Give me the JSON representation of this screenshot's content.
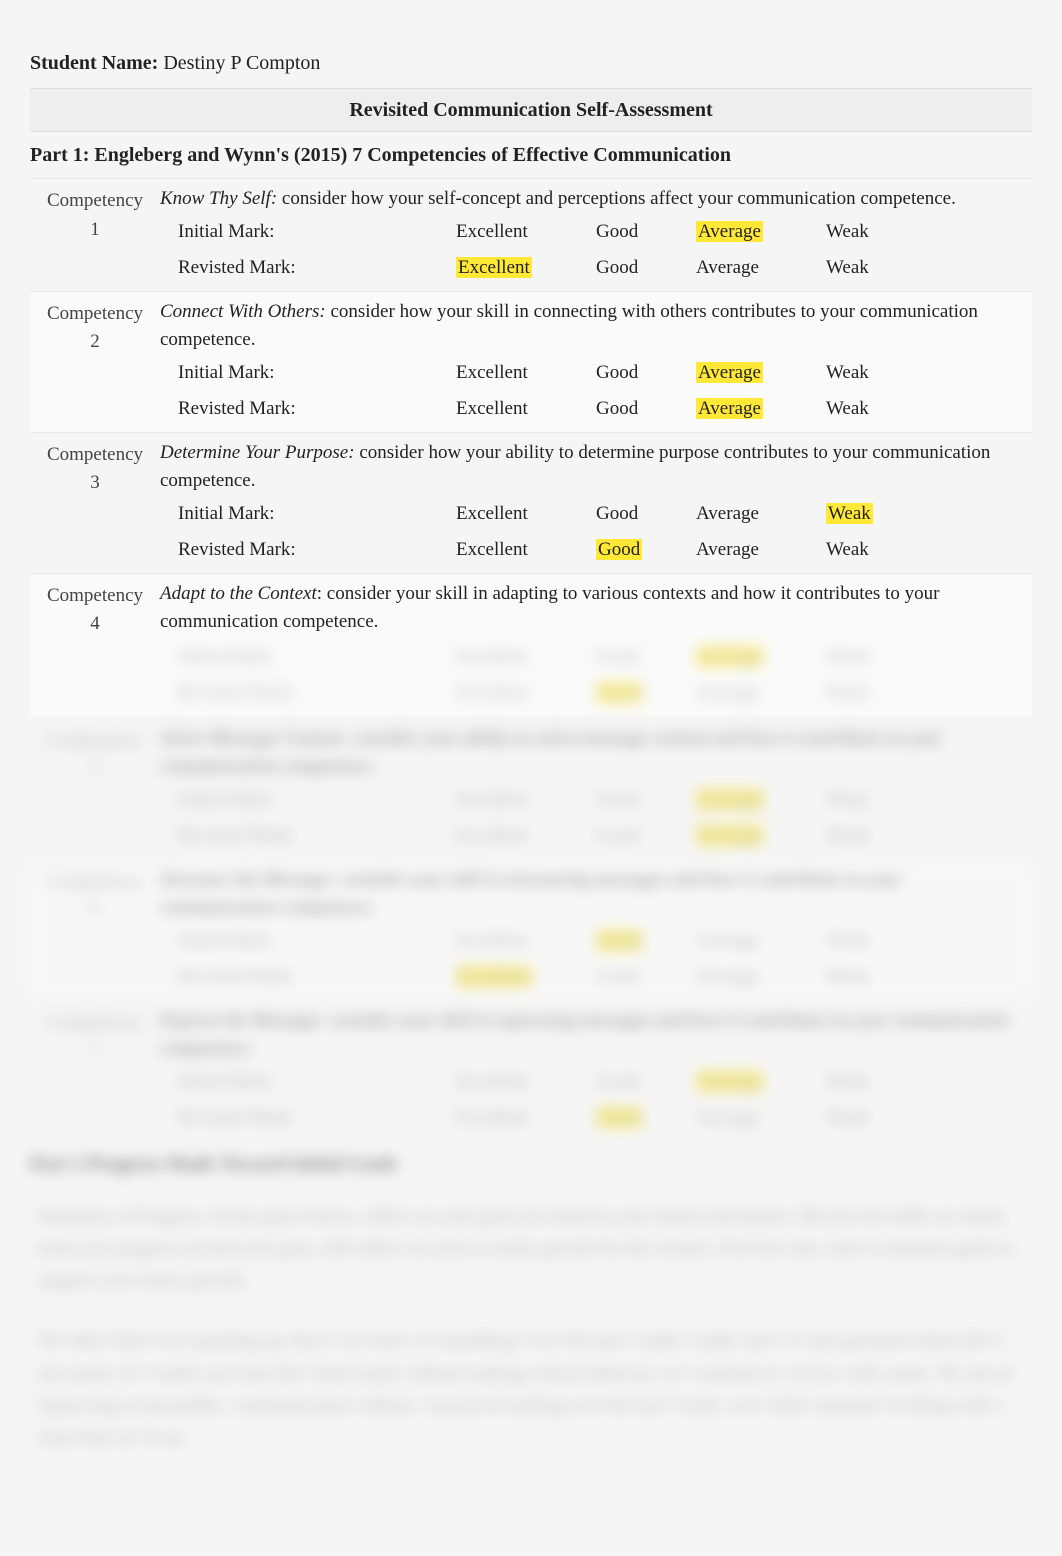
{
  "student": {
    "label": "Student Name:",
    "name": "Destiny P Compton"
  },
  "title": "Revisited Communication Self-Assessment",
  "part1_header": "Part 1: Engleberg and Wynn's (2015) 7 Competencies of Effective Communication",
  "ratings": {
    "excellent": "Excellent",
    "good": "Good",
    "average": "Average",
    "weak": "Weak"
  },
  "marks": {
    "initial": "Initial Mark:",
    "revisted": "Revisted Mark:"
  },
  "comp": {
    "c1": {
      "label_a": "Competency",
      "label_b": "1",
      "title": "Know Thy Self:",
      "desc": " consider how your self-concept and perceptions affect your communication competence.",
      "initial_hl": "average",
      "revisted_hl": "excellent"
    },
    "c2": {
      "label_a": "Competency",
      "label_b": "2",
      "title": "Connect With Others:",
      "desc": " consider how your skill in connecting with others contributes to your communication competence.",
      "initial_hl": "average",
      "revisted_hl": "average"
    },
    "c3": {
      "label_a": "Competency",
      "label_b": "3",
      "title": "Determine Your Purpose:",
      "desc": " consider how your ability to determine purpose contributes to your communication competence.",
      "initial_hl": "weak",
      "revisted_hl": "good"
    },
    "c4": {
      "label_a": "Competency",
      "label_b": "4",
      "title": "Adapt to the Context",
      "desc": ": consider your skill in adapting to various contexts and how it contributes to your communication competence."
    }
  },
  "blurred": {
    "c4_initial_hl": "average",
    "c4_revisted_hl": "good",
    "c5": {
      "label_a": "Competency",
      "label_b": "5",
      "desc": "Select Message Content: consider your ability to select message content and how it contributes to your communication competence.",
      "initial_hl": "average",
      "revisted_hl": "average"
    },
    "c6": {
      "label_a": "Competency",
      "label_b": "6",
      "desc": "Structure the Message: consider your skill in structuring messages and how it contributes to your communication competence.",
      "initial_hl": "good",
      "revisted_hl": "excellent"
    },
    "c7": {
      "label_a": "Competency",
      "label_b": "7",
      "desc": "Express the Message: consider your skill in expressing messages and how it contributes to your communication competence.",
      "initial_hl": "average",
      "revisted_hl": "good"
    },
    "part2_header": "Part 2 Progress Made Toward Initial Goals",
    "summary_label": "Summary of Progress:",
    "summary_text": " In the space below, reflect on each goal you listed in your initial assessment. Discuss the skills on which most you progress toward each goal, still reflect on areas to make growth for the session. Feel free also, here to mention goals to support your future growth.",
    "para2": "We often find it not speaking up, that I can learn, or something. Over the part I make I make sure's to ask questions about this I am unsure of. I make sure that this I don't make without making critical behavior, so I continue to, review with, notes. We am an improving at non-public, communication without. I practiced settling over the last I week, over while someone is telling with a class they are in an."
  }
}
